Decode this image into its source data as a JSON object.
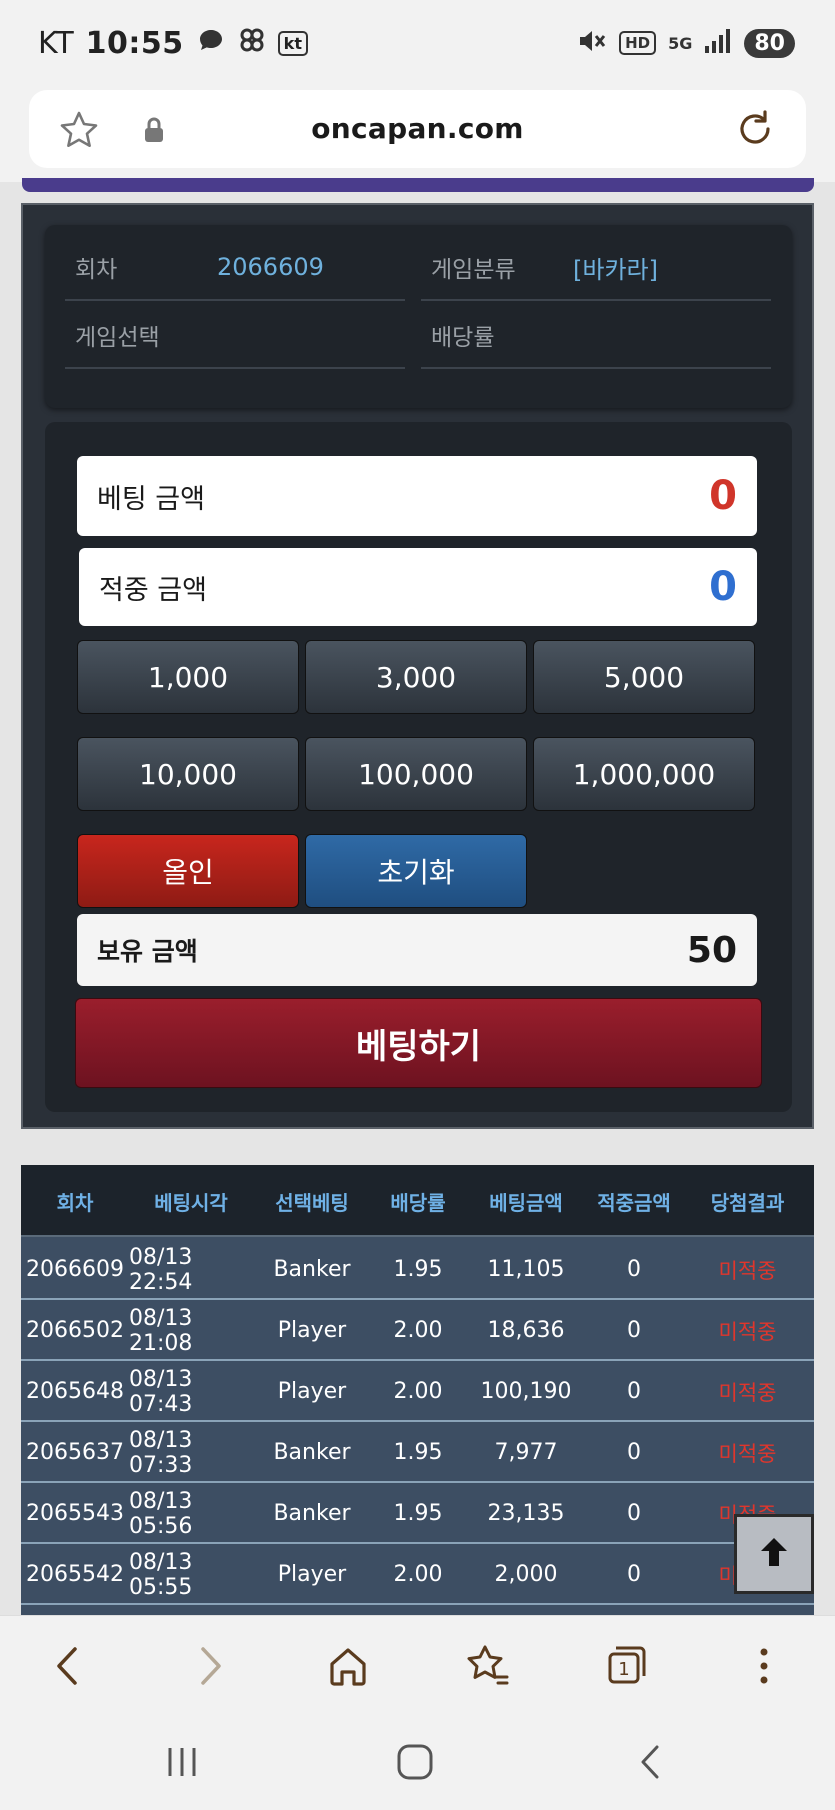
{
  "status_bar": {
    "carrier": "KT",
    "time": "10:55",
    "kt_badge": "kt",
    "hd_badge": "HD",
    "network": "5G",
    "battery": "80"
  },
  "browser": {
    "url": "oncapan.com"
  },
  "info": {
    "round_label": "회차",
    "round_value": "2066609",
    "game_category_label": "게임분류",
    "game_category_value": "[바카라]",
    "game_select_label": "게임선택",
    "odds_label": "배당률"
  },
  "bet": {
    "bet_amount_label": "베팅 금액",
    "bet_amount_value": "0",
    "win_amount_label": "적중 금액",
    "win_amount_value": "0",
    "chips": [
      "1,000",
      "3,000",
      "5,000",
      "10,000",
      "100,000",
      "1,000,000"
    ],
    "allin_label": "올인",
    "reset_label": "초기화",
    "balance_label": "보유 금액",
    "balance_value": "50",
    "submit_label": "베팅하기"
  },
  "history": {
    "headers": [
      "회차",
      "베팅시각",
      "선택베팅",
      "배당률",
      "베팅금액",
      "적중금액",
      "당첨결과"
    ],
    "rows": [
      [
        "2066609",
        "08/13 22:54",
        "Banker",
        "1.95",
        "11,105",
        "0",
        "미적중"
      ],
      [
        "2066502",
        "08/13 21:08",
        "Player",
        "2.00",
        "18,636",
        "0",
        "미적중"
      ],
      [
        "2065648",
        "08/13 07:43",
        "Player",
        "2.00",
        "100,190",
        "0",
        "미적중"
      ],
      [
        "2065637",
        "08/13 07:33",
        "Banker",
        "1.95",
        "7,977",
        "0",
        "미적중"
      ],
      [
        "2065543",
        "08/13 05:56",
        "Banker",
        "1.95",
        "23,135",
        "0",
        "미적중"
      ],
      [
        "2065542",
        "08/13 05:55",
        "Player",
        "2.00",
        "2,000",
        "0",
        "미적중"
      ]
    ]
  },
  "colors": {
    "accent_blue": "#6fb1dd",
    "bet_red": "#d0352a",
    "win_blue": "#2f6fd0",
    "submit_red": "#8a1a26",
    "miss_red": "#e0362c"
  }
}
